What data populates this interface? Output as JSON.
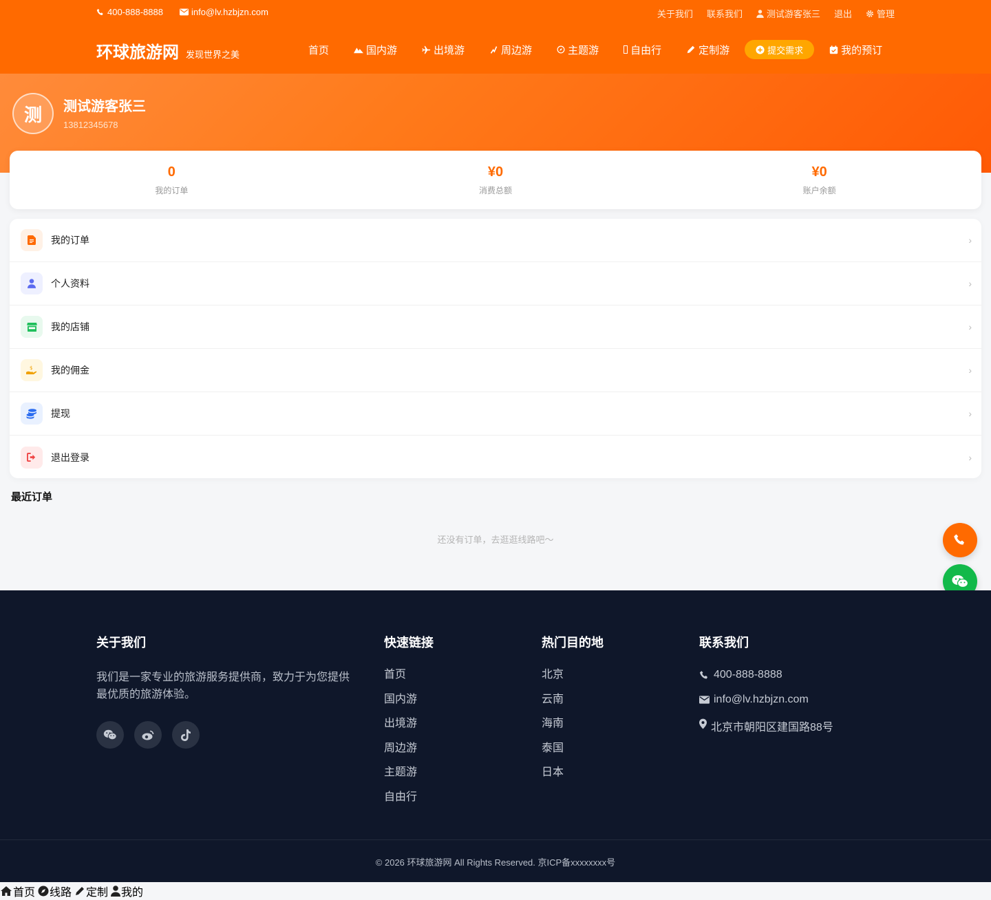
{
  "topbar": {
    "phone": "400-888-8888",
    "email": "info@lv.hzbjzn.com",
    "links": {
      "about": "关于我们",
      "contact": "联系我们",
      "user": "测试游客张三",
      "logout": "退出",
      "admin": "管理"
    }
  },
  "brand": {
    "name": "环球旅游网",
    "slogan": "发现世界之美"
  },
  "nav": {
    "home": "首页",
    "domestic": "国内游",
    "outbound": "出境游",
    "nearby": "周边游",
    "theme": "主题游",
    "free": "自由行",
    "custom": "定制游",
    "submit": "提交需求",
    "bookings": "我的预订"
  },
  "profile": {
    "avatar_char": "测",
    "name": "测试游客张三",
    "phone": "13812345678"
  },
  "stats": [
    {
      "value": "0",
      "label": "我的订单"
    },
    {
      "value": "¥0",
      "label": "消费总额"
    },
    {
      "value": "¥0",
      "label": "账户余额"
    }
  ],
  "menu": [
    {
      "label": "我的订单",
      "icon": "file-invoice-icon",
      "color": "#ff6a00",
      "bg": "#fff1e6"
    },
    {
      "label": "个人资料",
      "icon": "user-icon",
      "color": "#5b6bf0",
      "bg": "#eef0ff"
    },
    {
      "label": "我的店铺",
      "icon": "store-icon",
      "color": "#1fbf5c",
      "bg": "#e8f9ee"
    },
    {
      "label": "我的佣金",
      "icon": "hand-coin-icon",
      "color": "#f0a000",
      "bg": "#fff7e0"
    },
    {
      "label": "提现",
      "icon": "coins-icon",
      "color": "#2b6cf0",
      "bg": "#e9f1ff"
    },
    {
      "label": "退出登录",
      "icon": "sign-out-icon",
      "color": "#ef4444",
      "bg": "#ffeaea"
    }
  ],
  "menu_arrow": "›",
  "recent": {
    "title": "最近订单",
    "empty": "还没有订单，去逛逛线路吧～"
  },
  "footer": {
    "about": {
      "title": "关于我们",
      "text": "我们是一家专业的旅游服务提供商，致力于为您提供最优质的旅游体验。"
    },
    "quick": {
      "title": "快速链接",
      "links": [
        "首页",
        "国内游",
        "出境游",
        "周边游",
        "主题游",
        "自由行"
      ]
    },
    "hot": {
      "title": "热门目的地",
      "links": [
        "北京",
        "云南",
        "海南",
        "泰国",
        "日本"
      ]
    },
    "contact": {
      "title": "联系我们",
      "phone": "400-888-8888",
      "email": "info@lv.hzbjzn.com",
      "address": "北京市朝阳区建国路88号"
    },
    "copyright": "© 2026 环球旅游网 All Rights Reserved. 京ICP备xxxxxxxx号"
  },
  "tabbar": {
    "home": "首页",
    "routes": "线路",
    "custom": "定制",
    "mine": "我的"
  },
  "colors": {
    "brand": "#ff6a00",
    "footer_bg": "#0f172a",
    "cta": "#ffa600",
    "wechat": "#12b94a"
  }
}
